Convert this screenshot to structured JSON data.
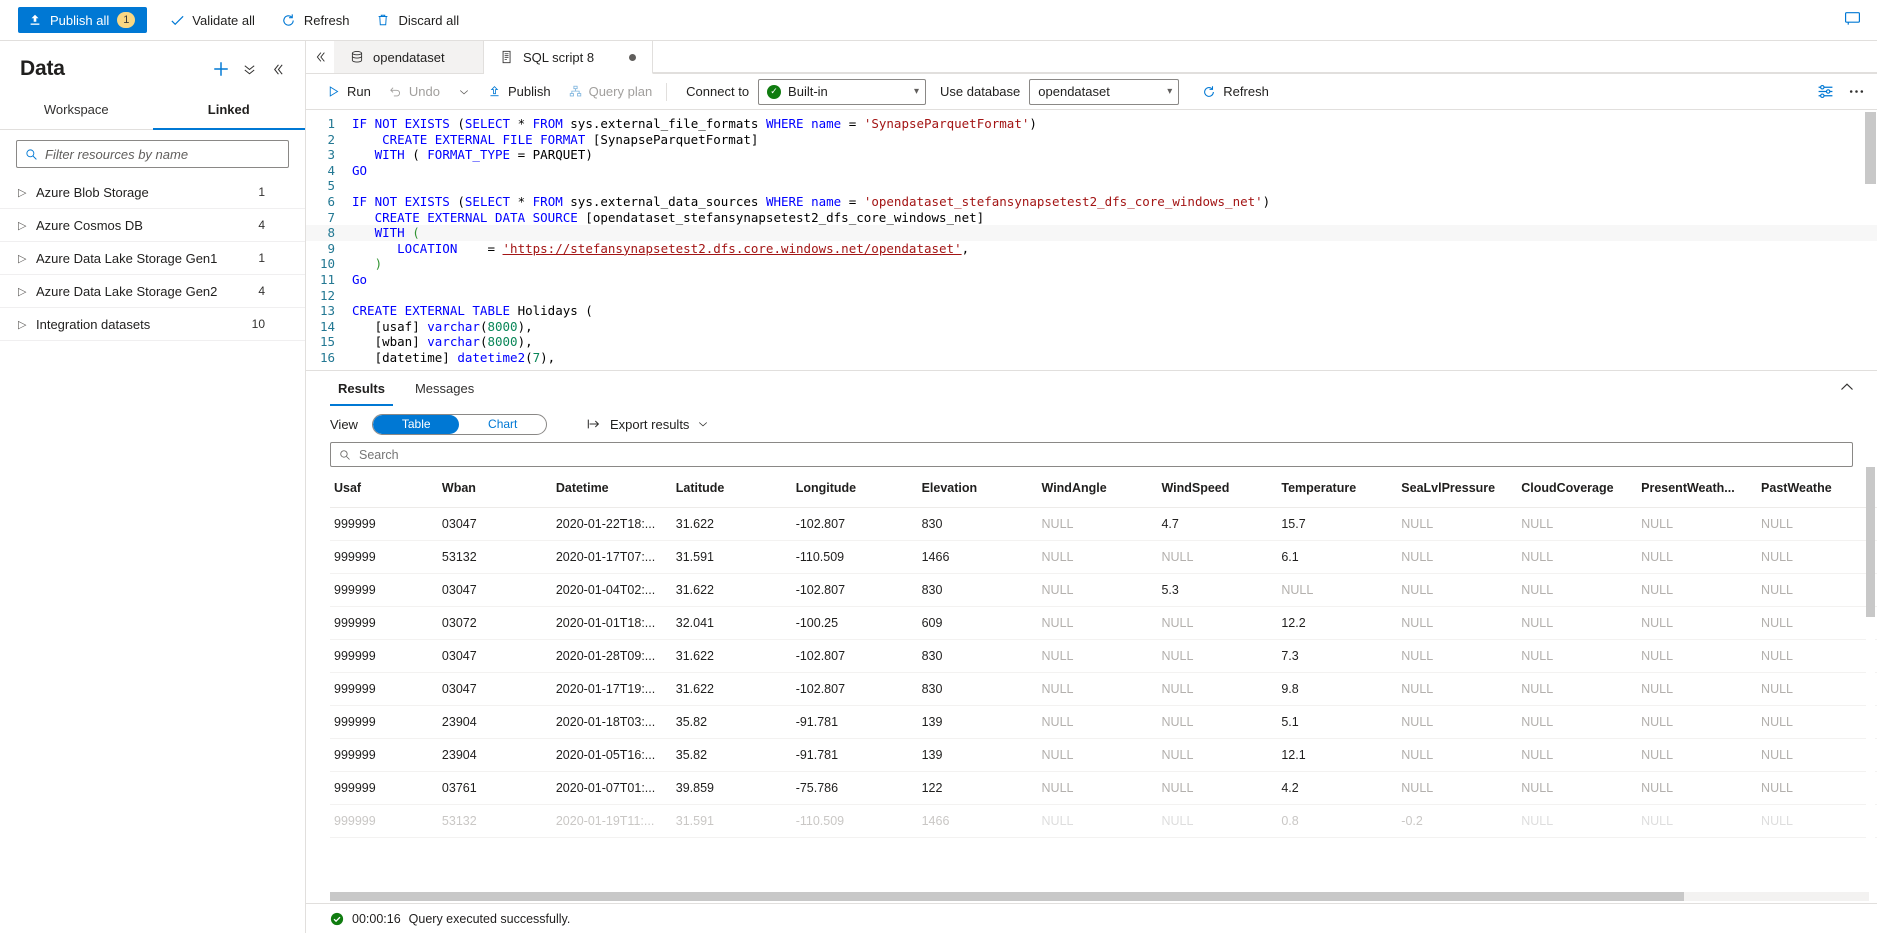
{
  "topbar": {
    "publish_all": "Publish all",
    "publish_badge": "1",
    "validate_all": "Validate all",
    "refresh": "Refresh",
    "discard_all": "Discard all",
    "feedback_icon": "feedback-icon",
    "accent": "#0078d4"
  },
  "sidebar": {
    "title": "Data",
    "add_icon": "plus-icon",
    "actions_icon": "chevron-double-down-icon",
    "collapse_icon": "chevron-double-left-icon",
    "tabs": [
      {
        "label": "Workspace",
        "active": false
      },
      {
        "label": "Linked",
        "active": true
      }
    ],
    "filter_placeholder": "Filter resources by name",
    "filter_value": "",
    "search_icon": "search-icon",
    "items": [
      {
        "label": "Azure Blob Storage",
        "count": "1"
      },
      {
        "label": "Azure Cosmos DB",
        "count": "4"
      },
      {
        "label": "Azure Data Lake Storage Gen1",
        "count": "1"
      },
      {
        "label": "Azure Data Lake Storage Gen2",
        "count": "4"
      },
      {
        "label": "Integration datasets",
        "count": "10"
      }
    ]
  },
  "editor": {
    "collapse_icon": "chevron-double-left-icon",
    "tabs": [
      {
        "label": "opendataset",
        "icon": "database-icon",
        "active": false,
        "dirty": false
      },
      {
        "label": "SQL script 8",
        "icon": "sql-script-icon",
        "active": true,
        "dirty": true
      }
    ],
    "toolbar": {
      "run": "Run",
      "undo": "Undo",
      "undo_chevron": "chevron-down-icon",
      "publish": "Publish",
      "query_plan": "Query plan",
      "connect_to_label": "Connect to",
      "connect_to_value": "Built-in",
      "use_database_label": "Use database",
      "use_database_value": "opendataset",
      "refresh": "Refresh",
      "properties_icon": "properties-icon",
      "more_icon": "ellipsis-icon"
    },
    "code_lines": [
      {
        "n": 1,
        "tokens": [
          {
            "t": "IF NOT EXISTS ",
            "c": "k"
          },
          {
            "t": "(",
            "c": "plain"
          },
          {
            "t": "SELECT ",
            "c": "k"
          },
          {
            "t": "* ",
            "c": "plain"
          },
          {
            "t": "FROM ",
            "c": "k"
          },
          {
            "t": "sys.external_file_formats ",
            "c": "plain"
          },
          {
            "t": "WHERE ",
            "c": "k"
          },
          {
            "t": "name ",
            "c": "t"
          },
          {
            "t": "= ",
            "c": "plain"
          },
          {
            "t": "'SynapseParquetFormat'",
            "c": "s"
          },
          {
            "t": ")",
            "c": "plain"
          }
        ]
      },
      {
        "n": 2,
        "tokens": [
          {
            "t": "    ",
            "c": "plain"
          },
          {
            "t": "CREATE EXTERNAL FILE FORMAT ",
            "c": "k"
          },
          {
            "t": "[SynapseParquetFormat]",
            "c": "plain"
          }
        ]
      },
      {
        "n": 3,
        "tokens": [
          {
            "t": "   ",
            "c": "plain"
          },
          {
            "t": "WITH ",
            "c": "k"
          },
          {
            "t": "( ",
            "c": "plain"
          },
          {
            "t": "FORMAT_TYPE ",
            "c": "t"
          },
          {
            "t": "= PARQUET)",
            "c": "plain"
          }
        ]
      },
      {
        "n": 4,
        "tokens": [
          {
            "t": "GO",
            "c": "k"
          }
        ]
      },
      {
        "n": 5,
        "tokens": []
      },
      {
        "n": 6,
        "tokens": [
          {
            "t": "IF NOT EXISTS ",
            "c": "k"
          },
          {
            "t": "(",
            "c": "plain"
          },
          {
            "t": "SELECT ",
            "c": "k"
          },
          {
            "t": "* ",
            "c": "plain"
          },
          {
            "t": "FROM ",
            "c": "k"
          },
          {
            "t": "sys.external_data_sources ",
            "c": "plain"
          },
          {
            "t": "WHERE ",
            "c": "k"
          },
          {
            "t": "name ",
            "c": "t"
          },
          {
            "t": "= ",
            "c": "plain"
          },
          {
            "t": "'opendataset_stefansynapsetest2_dfs_core_windows_net'",
            "c": "s"
          },
          {
            "t": ")",
            "c": "plain"
          }
        ]
      },
      {
        "n": 7,
        "tokens": [
          {
            "t": "   ",
            "c": "plain"
          },
          {
            "t": "CREATE EXTERNAL DATA SOURCE ",
            "c": "k"
          },
          {
            "t": "[opendataset_stefansynapsetest2_dfs_core_windows_net]",
            "c": "plain"
          }
        ]
      },
      {
        "n": 8,
        "tokens": [
          {
            "t": "   ",
            "c": "plain"
          },
          {
            "t": "WITH ",
            "c": "k"
          },
          {
            "t": "(",
            "c": "bracket"
          }
        ]
      },
      {
        "n": 9,
        "tokens": [
          {
            "t": "      ",
            "c": "plain"
          },
          {
            "t": "LOCATION",
            "c": "t"
          },
          {
            "t": "    = ",
            "c": "plain"
          },
          {
            "t": "'https://stefansynapsetest2.dfs.core.windows.net/opendataset'",
            "c": "lnk"
          },
          {
            "t": ",",
            "c": "plain"
          }
        ]
      },
      {
        "n": 10,
        "tokens": [
          {
            "t": "   ",
            "c": "plain"
          },
          {
            "t": ")",
            "c": "bracket"
          }
        ]
      },
      {
        "n": 11,
        "tokens": [
          {
            "t": "Go",
            "c": "k"
          }
        ]
      },
      {
        "n": 12,
        "tokens": []
      },
      {
        "n": 13,
        "tokens": [
          {
            "t": "CREATE EXTERNAL TABLE ",
            "c": "k"
          },
          {
            "t": "Holidays (",
            "c": "plain"
          }
        ]
      },
      {
        "n": 14,
        "tokens": [
          {
            "t": "   [usaf] ",
            "c": "plain"
          },
          {
            "t": "varchar",
            "c": "k"
          },
          {
            "t": "(",
            "c": "plain"
          },
          {
            "t": "8000",
            "c": "n"
          },
          {
            "t": "),",
            "c": "plain"
          }
        ]
      },
      {
        "n": 15,
        "tokens": [
          {
            "t": "   [wban] ",
            "c": "plain"
          },
          {
            "t": "varchar",
            "c": "k"
          },
          {
            "t": "(",
            "c": "plain"
          },
          {
            "t": "8000",
            "c": "n"
          },
          {
            "t": "),",
            "c": "plain"
          }
        ]
      },
      {
        "n": 16,
        "tokens": [
          {
            "t": "   [datetime] ",
            "c": "plain"
          },
          {
            "t": "datetime2",
            "c": "k"
          },
          {
            "t": "(",
            "c": "plain"
          },
          {
            "t": "7",
            "c": "n"
          },
          {
            "t": "),",
            "c": "plain"
          }
        ]
      }
    ]
  },
  "results": {
    "tabs": [
      {
        "label": "Results",
        "active": true
      },
      {
        "label": "Messages",
        "active": false
      }
    ],
    "collapse_icon": "chevron-up-icon",
    "view_label": "View",
    "view_options": [
      {
        "label": "Table",
        "active": true
      },
      {
        "label": "Chart",
        "active": false
      }
    ],
    "export_label": "Export results",
    "export_icon": "export-icon",
    "export_chevron": "chevron-down-icon",
    "search_placeholder": "Search",
    "search_value": "",
    "search_icon": "search-icon",
    "columns": [
      "Usaf",
      "Wban",
      "Datetime",
      "Latitude",
      "Longitude",
      "Elevation",
      "WindAngle",
      "WindSpeed",
      "Temperature",
      "SeaLvlPressure",
      "CloudCoverage",
      "PresentWeath...",
      "PastWeathe"
    ],
    "rows": [
      [
        "999999",
        "03047",
        "2020-01-22T18:...",
        "31.622",
        "-102.807",
        "830",
        "NULL",
        "4.7",
        "15.7",
        "NULL",
        "NULL",
        "NULL",
        "NULL"
      ],
      [
        "999999",
        "53132",
        "2020-01-17T07:...",
        "31.591",
        "-110.509",
        "1466",
        "NULL",
        "NULL",
        "6.1",
        "NULL",
        "NULL",
        "NULL",
        "NULL"
      ],
      [
        "999999",
        "03047",
        "2020-01-04T02:...",
        "31.622",
        "-102.807",
        "830",
        "NULL",
        "5.3",
        "NULL",
        "NULL",
        "NULL",
        "NULL",
        "NULL"
      ],
      [
        "999999",
        "03072",
        "2020-01-01T18:...",
        "32.041",
        "-100.25",
        "609",
        "NULL",
        "NULL",
        "12.2",
        "NULL",
        "NULL",
        "NULL",
        "NULL"
      ],
      [
        "999999",
        "03047",
        "2020-01-28T09:...",
        "31.622",
        "-102.807",
        "830",
        "NULL",
        "NULL",
        "7.3",
        "NULL",
        "NULL",
        "NULL",
        "NULL"
      ],
      [
        "999999",
        "03047",
        "2020-01-17T19:...",
        "31.622",
        "-102.807",
        "830",
        "NULL",
        "NULL",
        "9.8",
        "NULL",
        "NULL",
        "NULL",
        "NULL"
      ],
      [
        "999999",
        "23904",
        "2020-01-18T03:...",
        "35.82",
        "-91.781",
        "139",
        "NULL",
        "NULL",
        "5.1",
        "NULL",
        "NULL",
        "NULL",
        "NULL"
      ],
      [
        "999999",
        "23904",
        "2020-01-05T16:...",
        "35.82",
        "-91.781",
        "139",
        "NULL",
        "NULL",
        "12.1",
        "NULL",
        "NULL",
        "NULL",
        "NULL"
      ],
      [
        "999999",
        "03761",
        "2020-01-07T01:...",
        "39.859",
        "-75.786",
        "122",
        "NULL",
        "NULL",
        "4.2",
        "NULL",
        "NULL",
        "NULL",
        "NULL"
      ],
      [
        "999999",
        "53132",
        "2020-01-19T11:...",
        "31.591",
        "-110.509",
        "1466",
        "NULL",
        "NULL",
        "0.8",
        "-0.2",
        "NULL",
        "NULL",
        "NULL"
      ]
    ]
  },
  "statusbar": {
    "status_icon": "success-check-icon",
    "elapsed": "00:00:16",
    "message": "Query executed successfully.",
    "success_color": "#107c10"
  }
}
